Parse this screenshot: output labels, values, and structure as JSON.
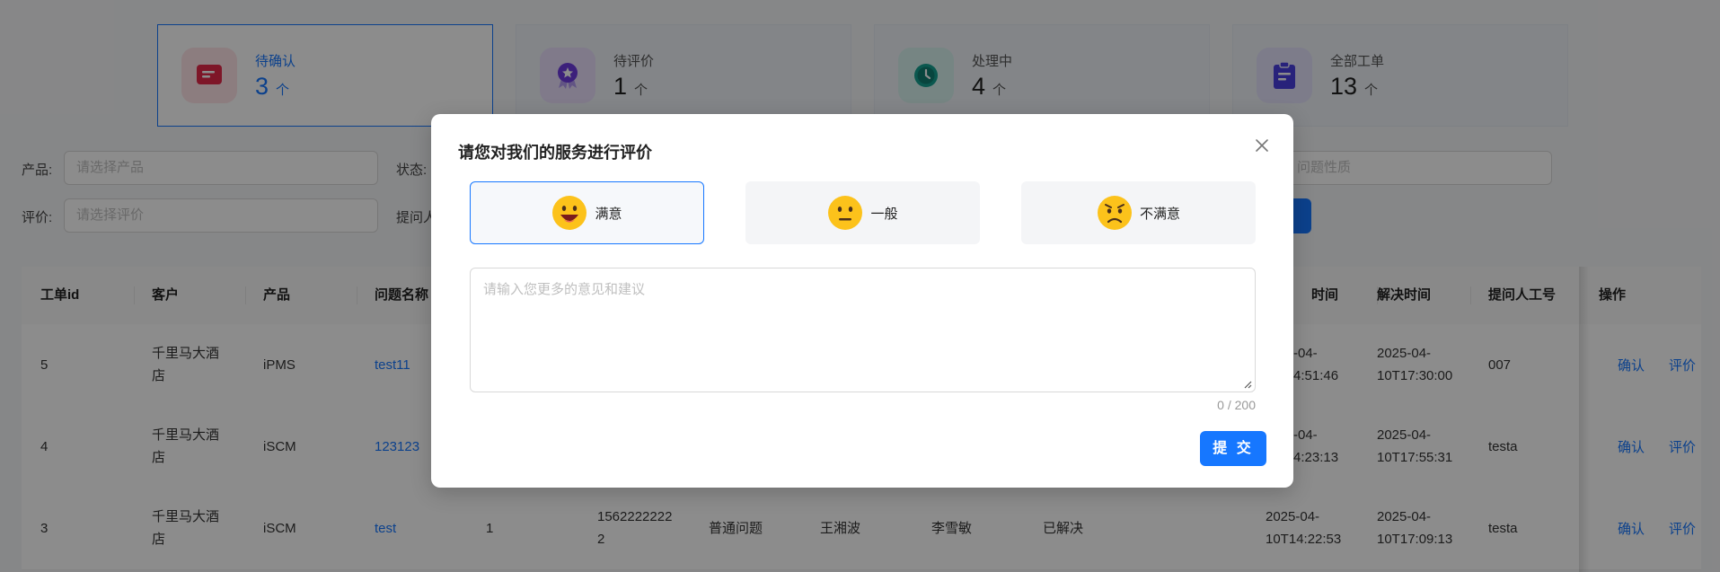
{
  "stats": [
    {
      "label": "待确认",
      "value": "3",
      "unit": "个",
      "icon": "message-icon",
      "color": "#e5284a",
      "bg": "#ffe3e8"
    },
    {
      "label": "待评价",
      "value": "1",
      "unit": "个",
      "icon": "award-badge-icon",
      "color": "#6d3be0",
      "bg": "#e9defc"
    },
    {
      "label": "处理中",
      "value": "4",
      "unit": "个",
      "icon": "clock-icon",
      "color": "#14a090",
      "bg": "#d7f3ee"
    },
    {
      "label": "全部工单",
      "value": "13",
      "unit": "个",
      "icon": "clipboard-icon",
      "color": "#4a3fe0",
      "bg": "#e4e2fc"
    }
  ],
  "filters": {
    "product_label": "产品:",
    "product_placeholder": "请选择产品",
    "status_label": "状态:",
    "rating_label": "评价:",
    "rating_placeholder": "请选择评价",
    "asker_label": "提问人",
    "nature_placeholder": "问题性质"
  },
  "table": {
    "headers": [
      "工单id",
      "客户",
      "产品",
      "问题名称",
      "时间",
      "解决时间",
      "提问人工号",
      "操作"
    ],
    "rows": [
      {
        "id": "5",
        "customer_line1": "千里马大酒",
        "customer_line2": "店",
        "product": "iPMS",
        "name": "test11",
        "time_line1": "-04-",
        "time_line2": "4:51:46",
        "resolve_line1": "2025-04-",
        "resolve_line2": "10T17:30:00",
        "asker": "007"
      },
      {
        "id": "4",
        "customer_line1": "千里马大酒",
        "customer_line2": "店",
        "product": "iSCM",
        "name": "123123",
        "time_line1": "-04-",
        "time_line2": "4:23:13",
        "resolve_line1": "2025-04-",
        "resolve_line2": "10T17:55:31",
        "asker": "testa"
      },
      {
        "id": "3",
        "customer_line1": "千里马大酒",
        "customer_line2": "店",
        "product": "iSCM",
        "name": "test",
        "count": "1",
        "phone_line1": "1562222222",
        "phone_line2": "2",
        "type": "普通问题",
        "handler": "王湘波",
        "person": "李雪敏",
        "status": "已解决",
        "time_line1": "2025-04-",
        "time_line2": "10T14:22:53",
        "resolve_line1": "2025-04-",
        "resolve_line2": "10T17:09:13",
        "asker": "testa"
      }
    ],
    "op_confirm": "确认",
    "op_rate": "评价"
  },
  "modal": {
    "title": "请您对我们的服务进行评价",
    "options": [
      {
        "label": "满意",
        "icon": "smile-emoji-icon"
      },
      {
        "label": "一般",
        "icon": "neutral-emoji-icon"
      },
      {
        "label": "不满意",
        "icon": "frown-emoji-icon"
      }
    ],
    "selected": "满意",
    "textarea_placeholder": "请输入您更多的意见和建议",
    "counter": "0 / 200",
    "submit_label": "提 交"
  },
  "colors": {
    "primary": "#1677ff",
    "mask": "rgba(0,0,0,0.45)"
  }
}
